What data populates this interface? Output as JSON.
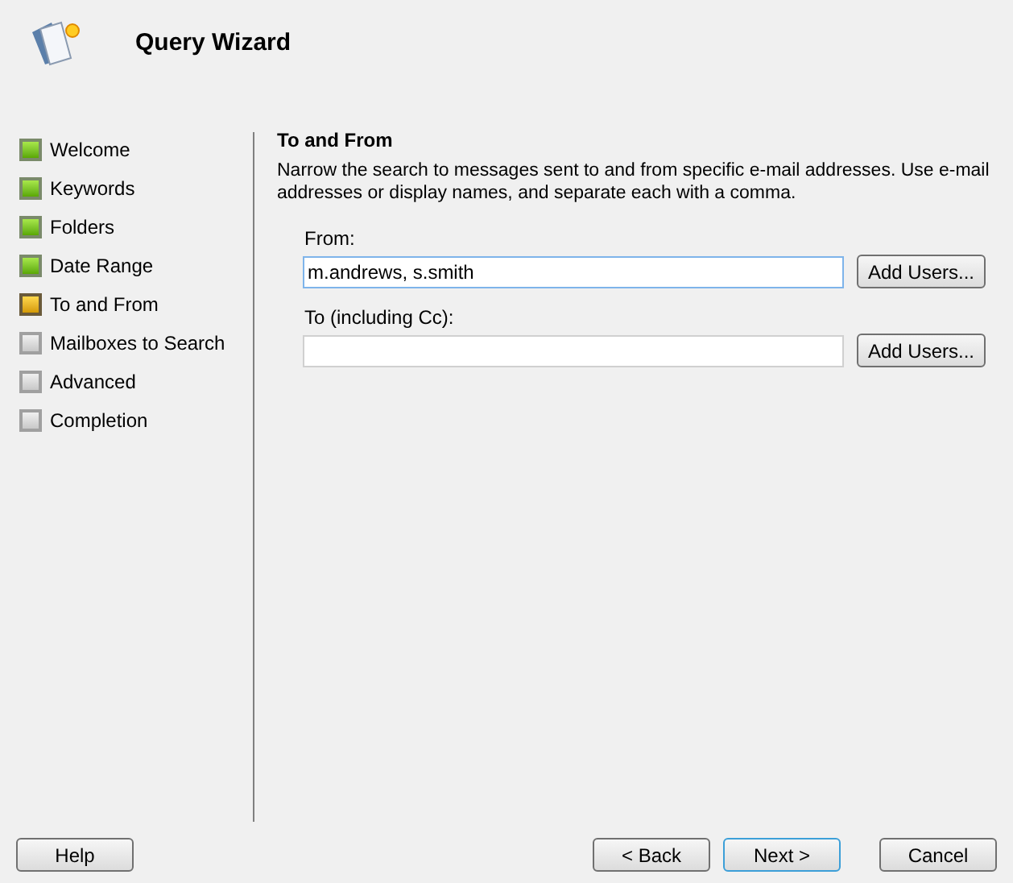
{
  "header": {
    "title": "Query Wizard"
  },
  "steps": [
    {
      "label": "Welcome",
      "kind": "done"
    },
    {
      "label": "Keywords",
      "kind": "done"
    },
    {
      "label": "Folders",
      "kind": "done"
    },
    {
      "label": "Date Range",
      "kind": "done"
    },
    {
      "label": "To and From",
      "kind": "current"
    },
    {
      "label": "Mailboxes to Search",
      "kind": "pending"
    },
    {
      "label": "Advanced",
      "kind": "pending"
    },
    {
      "label": "Completion",
      "kind": "pending"
    }
  ],
  "page": {
    "heading": "To and From",
    "description": "Narrow the search to messages sent to and from specific e-mail addresses. Use e-mail addresses or display names, and separate each with a comma.",
    "fields": [
      {
        "label": "From:",
        "value": "m.andrews, s.smith",
        "focused": true,
        "button": "Add Users..."
      },
      {
        "label": "To (including Cc):",
        "focused": false,
        "button": "Add Users..."
      }
    ]
  },
  "footer": {
    "help": "Help",
    "buttons": [
      {
        "label": "< Back",
        "default": false
      },
      {
        "label": "Next >",
        "default": true
      },
      {
        "label": "Cancel",
        "default": false
      }
    ]
  }
}
